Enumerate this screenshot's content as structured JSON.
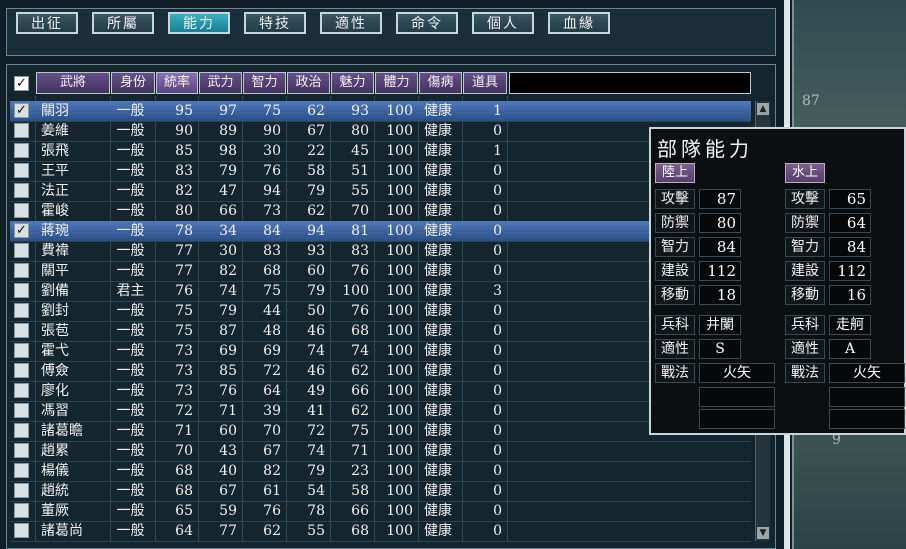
{
  "tabs": [
    "出征",
    "所屬",
    "能力",
    "特技",
    "適性",
    "命令",
    "個人",
    "血緣"
  ],
  "active_tab": 2,
  "headers": [
    "武將",
    "身份",
    "統率",
    "武力",
    "智力",
    "政治",
    "魅力",
    "體力",
    "傷病",
    "道具"
  ],
  "sorted_header": 2,
  "rows": [
    {
      "checked": true,
      "selected": true,
      "cells": [
        "關羽",
        "一般",
        "95",
        "97",
        "75",
        "62",
        "93",
        "100",
        "健康",
        "1"
      ]
    },
    {
      "checked": false,
      "selected": false,
      "cells": [
        "姜維",
        "一般",
        "90",
        "89",
        "90",
        "67",
        "80",
        "100",
        "健康",
        "0"
      ]
    },
    {
      "checked": false,
      "selected": false,
      "cells": [
        "張飛",
        "一般",
        "85",
        "98",
        "30",
        "22",
        "45",
        "100",
        "健康",
        "1"
      ]
    },
    {
      "checked": false,
      "selected": false,
      "cells": [
        "王平",
        "一般",
        "83",
        "79",
        "76",
        "58",
        "51",
        "100",
        "健康",
        "0"
      ]
    },
    {
      "checked": false,
      "selected": false,
      "cells": [
        "法正",
        "一般",
        "82",
        "47",
        "94",
        "79",
        "55",
        "100",
        "健康",
        "0"
      ]
    },
    {
      "checked": false,
      "selected": false,
      "cells": [
        "霍峻",
        "一般",
        "80",
        "66",
        "73",
        "62",
        "70",
        "100",
        "健康",
        "0"
      ]
    },
    {
      "checked": true,
      "selected": true,
      "cells": [
        "蔣琬",
        "一般",
        "78",
        "34",
        "84",
        "94",
        "81",
        "100",
        "健康",
        "0"
      ]
    },
    {
      "checked": false,
      "selected": false,
      "cells": [
        "費禕",
        "一般",
        "77",
        "30",
        "83",
        "93",
        "83",
        "100",
        "健康",
        "0"
      ]
    },
    {
      "checked": false,
      "selected": false,
      "cells": [
        "關平",
        "一般",
        "77",
        "82",
        "68",
        "60",
        "76",
        "100",
        "健康",
        "0"
      ]
    },
    {
      "checked": false,
      "selected": false,
      "cells": [
        "劉備",
        "君主",
        "76",
        "74",
        "75",
        "79",
        "100",
        "100",
        "健康",
        "3"
      ]
    },
    {
      "checked": false,
      "selected": false,
      "cells": [
        "劉封",
        "一般",
        "75",
        "79",
        "44",
        "50",
        "76",
        "100",
        "健康",
        "0"
      ]
    },
    {
      "checked": false,
      "selected": false,
      "cells": [
        "張苞",
        "一般",
        "75",
        "87",
        "48",
        "46",
        "68",
        "100",
        "健康",
        "0"
      ]
    },
    {
      "checked": false,
      "selected": false,
      "cells": [
        "霍弋",
        "一般",
        "73",
        "69",
        "69",
        "74",
        "74",
        "100",
        "健康",
        "0"
      ]
    },
    {
      "checked": false,
      "selected": false,
      "cells": [
        "傅僉",
        "一般",
        "73",
        "85",
        "72",
        "46",
        "62",
        "100",
        "健康",
        "0"
      ]
    },
    {
      "checked": false,
      "selected": false,
      "cells": [
        "廖化",
        "一般",
        "73",
        "76",
        "64",
        "49",
        "66",
        "100",
        "健康",
        "0"
      ]
    },
    {
      "checked": false,
      "selected": false,
      "cells": [
        "馮習",
        "一般",
        "72",
        "71",
        "39",
        "41",
        "62",
        "100",
        "健康",
        "0"
      ]
    },
    {
      "checked": false,
      "selected": false,
      "cells": [
        "諸葛瞻",
        "一般",
        "71",
        "60",
        "70",
        "72",
        "75",
        "100",
        "健康",
        "0"
      ]
    },
    {
      "checked": false,
      "selected": false,
      "cells": [
        "趙累",
        "一般",
        "70",
        "43",
        "67",
        "74",
        "71",
        "100",
        "健康",
        "0"
      ]
    },
    {
      "checked": false,
      "selected": false,
      "cells": [
        "楊儀",
        "一般",
        "68",
        "40",
        "82",
        "79",
        "23",
        "100",
        "健康",
        "0"
      ]
    },
    {
      "checked": false,
      "selected": false,
      "cells": [
        "趙統",
        "一般",
        "68",
        "67",
        "61",
        "54",
        "58",
        "100",
        "健康",
        "0"
      ]
    },
    {
      "checked": false,
      "selected": false,
      "cells": [
        "董厥",
        "一般",
        "65",
        "59",
        "76",
        "78",
        "66",
        "100",
        "健康",
        "0"
      ]
    },
    {
      "checked": false,
      "selected": false,
      "cells": [
        "諸葛尚",
        "一般",
        "64",
        "77",
        "62",
        "55",
        "68",
        "100",
        "健康",
        "0"
      ]
    }
  ],
  "popup": {
    "title": "部隊能力",
    "land": {
      "label": "陸上",
      "stats": [
        [
          "攻擊",
          "87"
        ],
        [
          "防禦",
          "80"
        ],
        [
          "智力",
          "84"
        ],
        [
          "建設",
          "112"
        ],
        [
          "移動",
          "18"
        ]
      ],
      "branch_label": "兵科",
      "branch": "井闌",
      "apt_label": "適性",
      "apt": "S",
      "tactic_label": "戰法",
      "tactic": "火矢"
    },
    "water": {
      "label": "水上",
      "stats": [
        [
          "攻擊",
          "65"
        ],
        [
          "防禦",
          "64"
        ],
        [
          "智力",
          "84"
        ],
        [
          "建設",
          "112"
        ],
        [
          "移動",
          "16"
        ]
      ],
      "branch_label": "兵科",
      "branch": "走舸",
      "apt_label": "適性",
      "apt": "A",
      "tactic_label": "戰法",
      "tactic": "火矢"
    }
  },
  "background_numbers": [
    "87",
    "9"
  ],
  "colors": {
    "selected_row": "#3f66a6",
    "header": "#5a4680",
    "active_tab": "#2a98ac"
  }
}
